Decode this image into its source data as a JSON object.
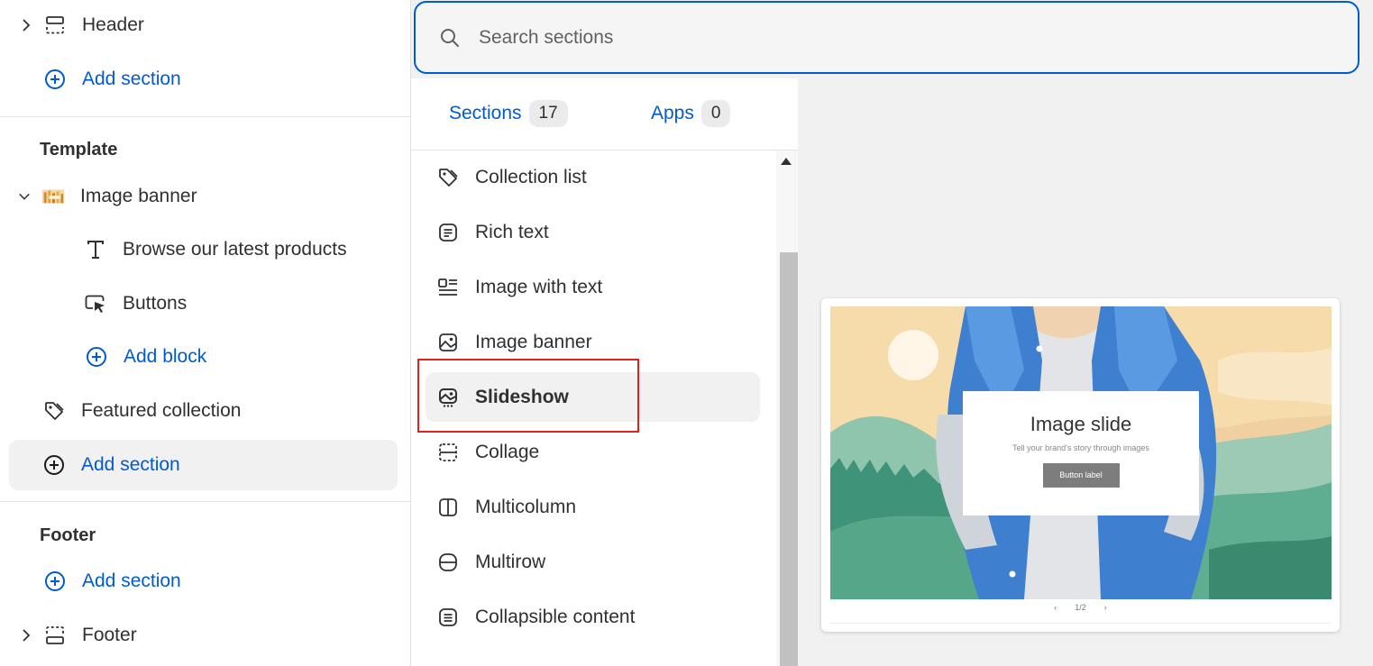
{
  "sidebar": {
    "header_label": "Header",
    "header_add_section": "Add section",
    "template_title": "Template",
    "image_banner_label": "Image banner",
    "browse_label": "Browse our latest products",
    "buttons_label": "Buttons",
    "add_block_label": "Add block",
    "featured_collection_label": "Featured collection",
    "template_add_section": "Add section",
    "footer_title": "Footer",
    "footer_add_section": "Add section",
    "footer_label": "Footer"
  },
  "search": {
    "placeholder": "Search sections"
  },
  "tabs": [
    {
      "label": "Sections",
      "count": "17"
    },
    {
      "label": "Apps",
      "count": "0"
    }
  ],
  "sections": [
    {
      "label": "Collection list",
      "icon": "tag-icon"
    },
    {
      "label": "Rich text",
      "icon": "text-block-icon"
    },
    {
      "label": "Image with text",
      "icon": "image-with-text-icon"
    },
    {
      "label": "Image banner",
      "icon": "image-icon"
    },
    {
      "label": "Slideshow",
      "icon": "slideshow-icon",
      "selected": true
    },
    {
      "label": "Collage",
      "icon": "collage-icon"
    },
    {
      "label": "Multicolumn",
      "icon": "multicolumn-icon"
    },
    {
      "label": "Multirow",
      "icon": "multirow-icon"
    },
    {
      "label": "Collapsible content",
      "icon": "collapsible-icon"
    }
  ],
  "preview": {
    "slide_title": "Image slide",
    "slide_subtitle": "Tell your brand's story through images",
    "slide_button": "Button label",
    "pager": "1/2",
    "prev": "‹",
    "next": "›"
  },
  "colors": {
    "accent": "#005bd3",
    "highlight_border": "#e0201e",
    "selected_bg": "#f1f1f1"
  }
}
